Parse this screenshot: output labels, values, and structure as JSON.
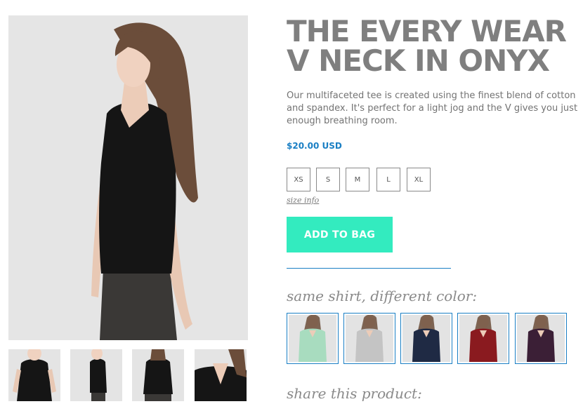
{
  "product": {
    "title": "THE EVERY WEAR V NECK IN ONYX",
    "description": "Our multifaceted tee is created using the finest blend of cotton and spandex. It's perfect for a light jog and the V gives you just enough breathing room.",
    "price": "$20.00 USD",
    "sizes": [
      "XS",
      "S",
      "M",
      "L",
      "XL"
    ],
    "size_info_label": "size info",
    "add_to_bag_label": "ADD TO BAG",
    "colors_heading": "same shirt, different color:",
    "share_heading": "share this product:"
  },
  "colors": {
    "accent": "#1a7fc4",
    "button": "#33ebbf",
    "title": "#7f7f7f",
    "shirt_main": "#151515",
    "swatches": [
      "#a8dcbf",
      "#c4c4c4",
      "#1f2a44",
      "#8a1a1f",
      "#3b1f36"
    ]
  }
}
